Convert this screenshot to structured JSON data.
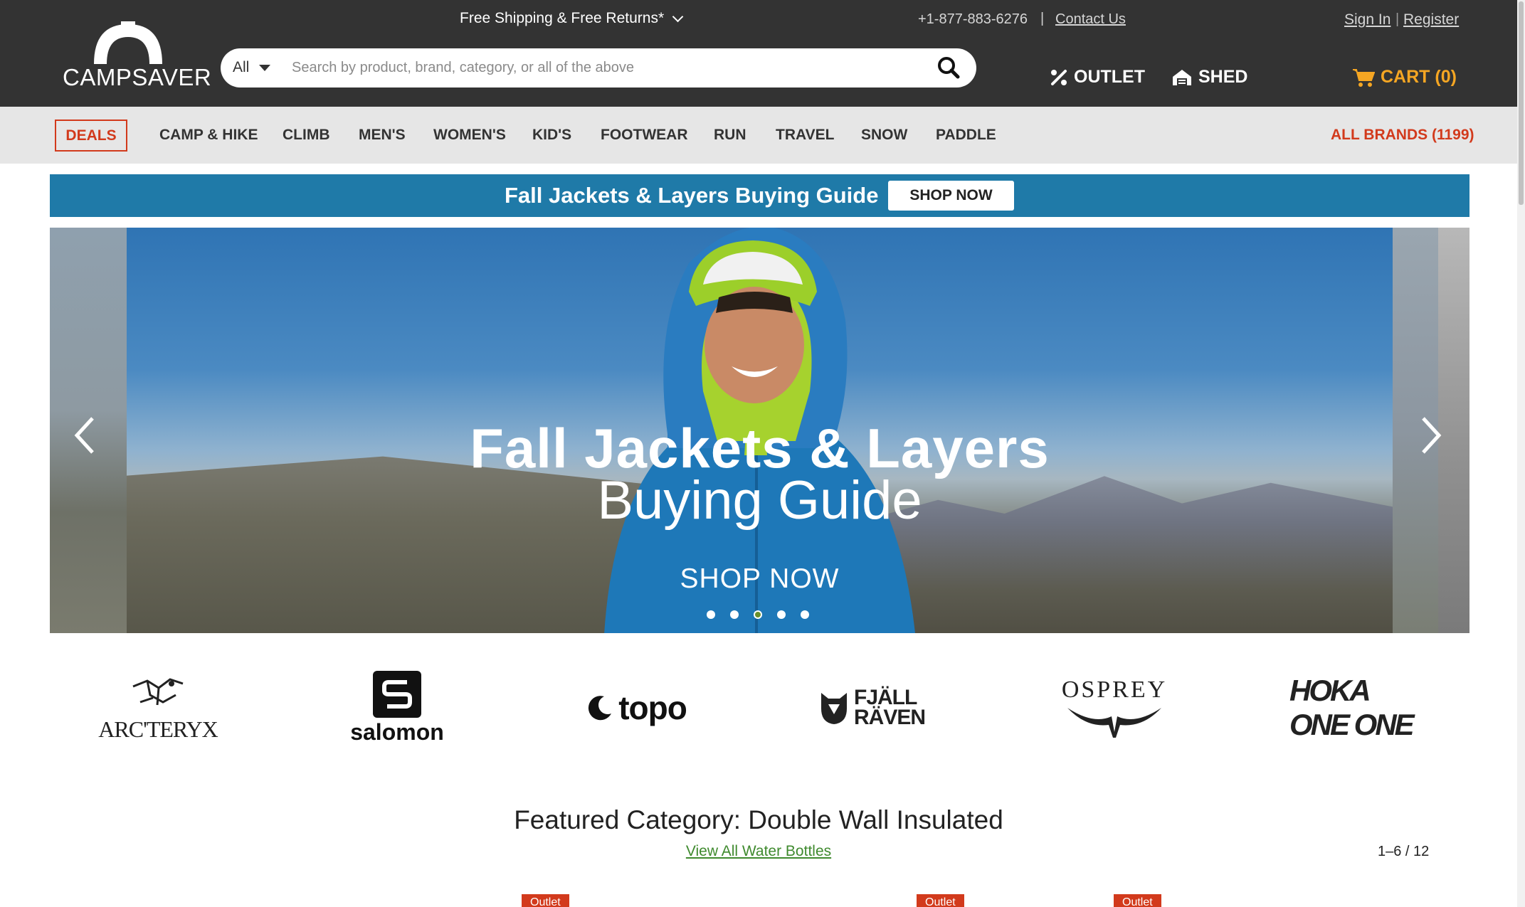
{
  "header": {
    "brand": "CAMPSAVER",
    "promo": "Free Shipping & Free Returns*",
    "phone": "+1-877-883-6276",
    "separator": "|",
    "contact": "Contact Us",
    "sign_in": "Sign In",
    "register": "Register",
    "search": {
      "category": "All",
      "placeholder": "Search by product, brand, category, or all of the above"
    },
    "outlet": "OUTLET",
    "shed": "SHED",
    "cart": "CART (0)"
  },
  "nav": {
    "deals": "DEALS",
    "items": [
      "CAMP & HIKE",
      "CLIMB",
      "MEN'S",
      "WOMEN'S",
      "KID'S",
      "FOOTWEAR",
      "RUN",
      "TRAVEL",
      "SNOW",
      "PADDLE"
    ],
    "all_brands": "ALL BRANDS (1199)"
  },
  "banner": {
    "text": "Fall Jackets & Layers Buying Guide",
    "button": "SHOP NOW",
    "color": "#1f7aa8"
  },
  "hero": {
    "title_line1": "Fall Jackets & Layers",
    "title_line2": "Buying Guide",
    "cta": "SHOP NOW",
    "slide_count": 5,
    "active_slide": 3
  },
  "brands": [
    {
      "name": "ARC'TERYX",
      "logo": "arcteryx-logo"
    },
    {
      "name": "salomon",
      "logo": "salomon-logo"
    },
    {
      "name": "topo",
      "logo": "topo-athletic-logo"
    },
    {
      "name": "FJÄLL RÄVEN",
      "logo": "fjallraven-logo"
    },
    {
      "name": "OSPREY",
      "logo": "osprey-logo"
    },
    {
      "name": "HOKA ONE ONE",
      "logo": "hoka-logo"
    }
  ],
  "featured": {
    "title": "Featured Category: Double Wall Insulated",
    "link": "View All Water Bottles",
    "pager": "1–6 / 12",
    "badge": "Outlet"
  },
  "colors": {
    "header_bg": "#333333",
    "nav_bg": "#e6e6e6",
    "accent_red": "#d23a1c",
    "cart_orange": "#f5a623",
    "link_green": "#3f8a2e"
  }
}
